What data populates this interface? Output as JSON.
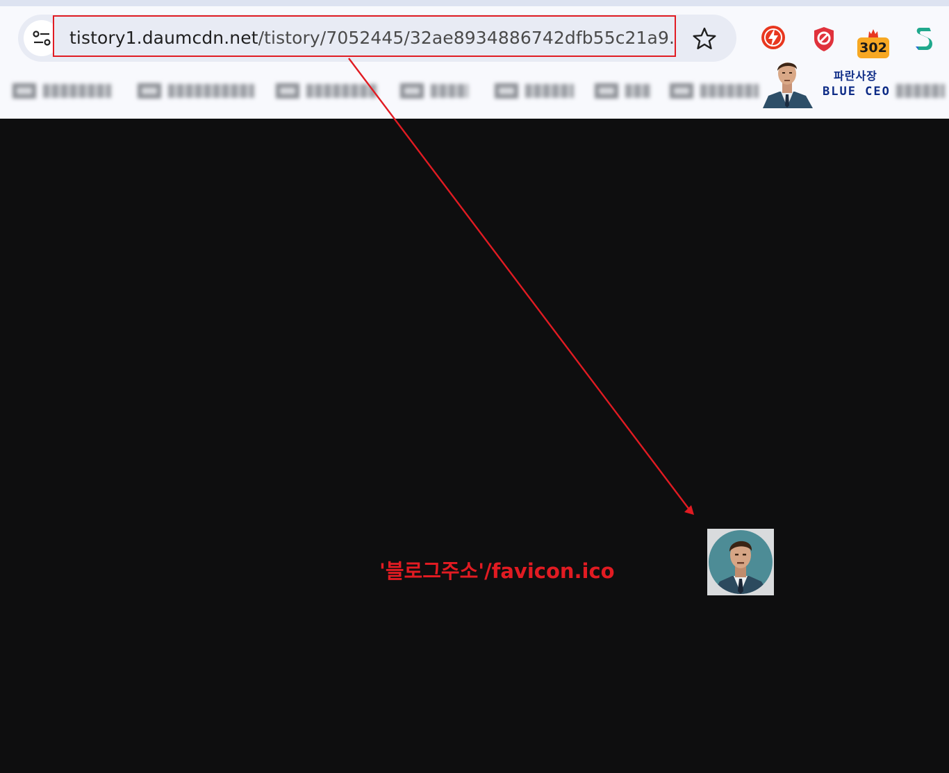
{
  "browser": {
    "address_bar": {
      "url_host": "tistory1.daumcdn.net",
      "url_path": "/tistory/7052445/32ae8934886742dfb55c21a9..."
    },
    "icons": {
      "site_info": "tune-icon",
      "bookmark": "star-icon"
    },
    "extensions": [
      {
        "name": "bolt-extension-icon",
        "color": "#e8371f"
      },
      {
        "name": "block-shield-extension-icon",
        "color": "#e0323c"
      },
      {
        "name": "counter-extension-icon",
        "badge": "302",
        "color": "#f7a823"
      },
      {
        "name": "s-extension-icon",
        "color": "#1fa88c"
      }
    ],
    "bookmarks_bar": {
      "note": ""
    }
  },
  "watermark": {
    "korean": "파란사장",
    "english": "BLUE CEO"
  },
  "annotation": {
    "caption": "'블로그주소'/favicon.ico",
    "color": "#e11b22"
  },
  "content": {
    "favicon_alt": "favicon-avatar-image"
  }
}
